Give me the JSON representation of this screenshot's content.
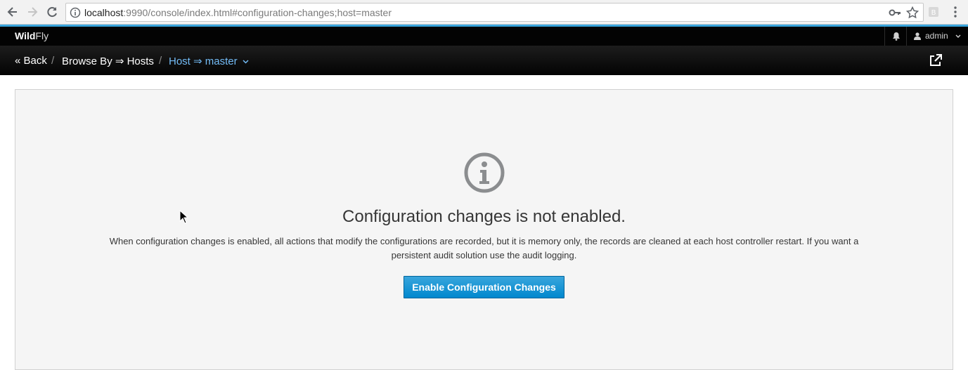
{
  "browser": {
    "url_host": "localhost",
    "url_rest": ":9990/console/index.html#configuration-changes;host=master",
    "icons": [
      "back-arrow-icon",
      "forward-arrow-icon",
      "reload-icon",
      "info-icon",
      "key-icon",
      "star-icon",
      "extension-icon",
      "menu-icon"
    ]
  },
  "header": {
    "brand_bold": "Wild",
    "brand_light": "Fly",
    "user": "admin"
  },
  "breadcrumb": {
    "back": "« Back",
    "sep1": "/",
    "browse": "Browse By ⇒ Hosts",
    "sep2": "/",
    "host": "Host ⇒ master"
  },
  "main": {
    "headline": "Configuration changes is not enabled.",
    "description": "When configuration changes is enabled, all actions that modify the configurations are recorded, but it is memory only, the records are cleaned at each host controller restart. If you want a persistent audit solution use the audit logging.",
    "enable_button": "Enable Configuration Changes"
  },
  "colors": {
    "accent": "#39a5dc",
    "link": "#73bcf7",
    "button": "#0088ce",
    "panel_bg": "#f5f5f5"
  }
}
